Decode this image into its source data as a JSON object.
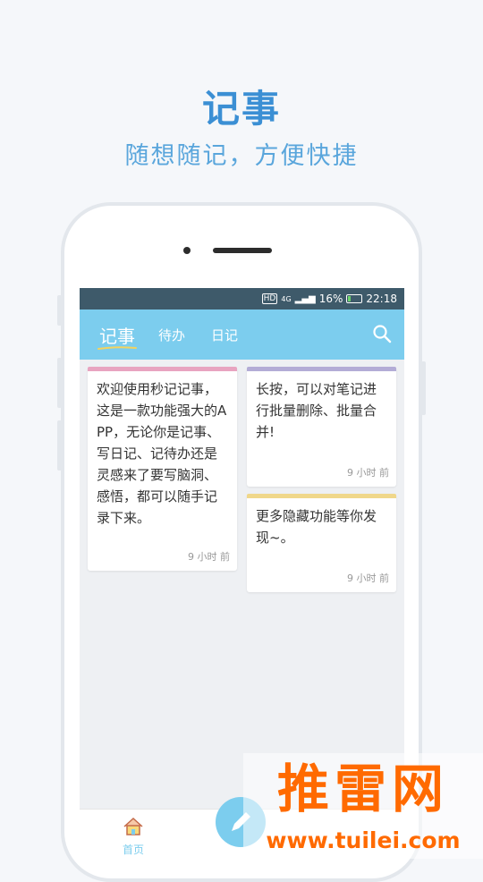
{
  "promo": {
    "title": "记事",
    "subtitle": "随想随记，方便快捷"
  },
  "status_bar": {
    "hd": "HD",
    "network": "4G",
    "battery_percent": "16%",
    "time": "22:18"
  },
  "tabs": [
    {
      "label": "记事",
      "active": true
    },
    {
      "label": "待办",
      "active": false
    },
    {
      "label": "日记",
      "active": false
    }
  ],
  "notes": [
    {
      "text": "欢迎使用秒记记事，这是一款功能强大的APP，无论你是记事、写日记、记待办还是灵感来了要写脑洞、感悟，都可以随手记录下来。",
      "time": "9 小时 前",
      "color": "#e8a4c0"
    },
    {
      "text": "长按，可以对笔记进行批量删除、批量合并!",
      "time": "9 小时 前",
      "color": "#b3acd6"
    },
    {
      "text": "更多隐藏功能等你发现~。",
      "time": "9 小时 前",
      "color": "#f0d78a"
    }
  ],
  "bottom_nav": {
    "home_label": "首页"
  },
  "watermark": {
    "brand": "推雷网",
    "url": "www.tuilei.com"
  },
  "colors": {
    "accent": "#7ccdee",
    "status_bar": "#3e5a6a",
    "promo_text": "#3b8fd4"
  }
}
